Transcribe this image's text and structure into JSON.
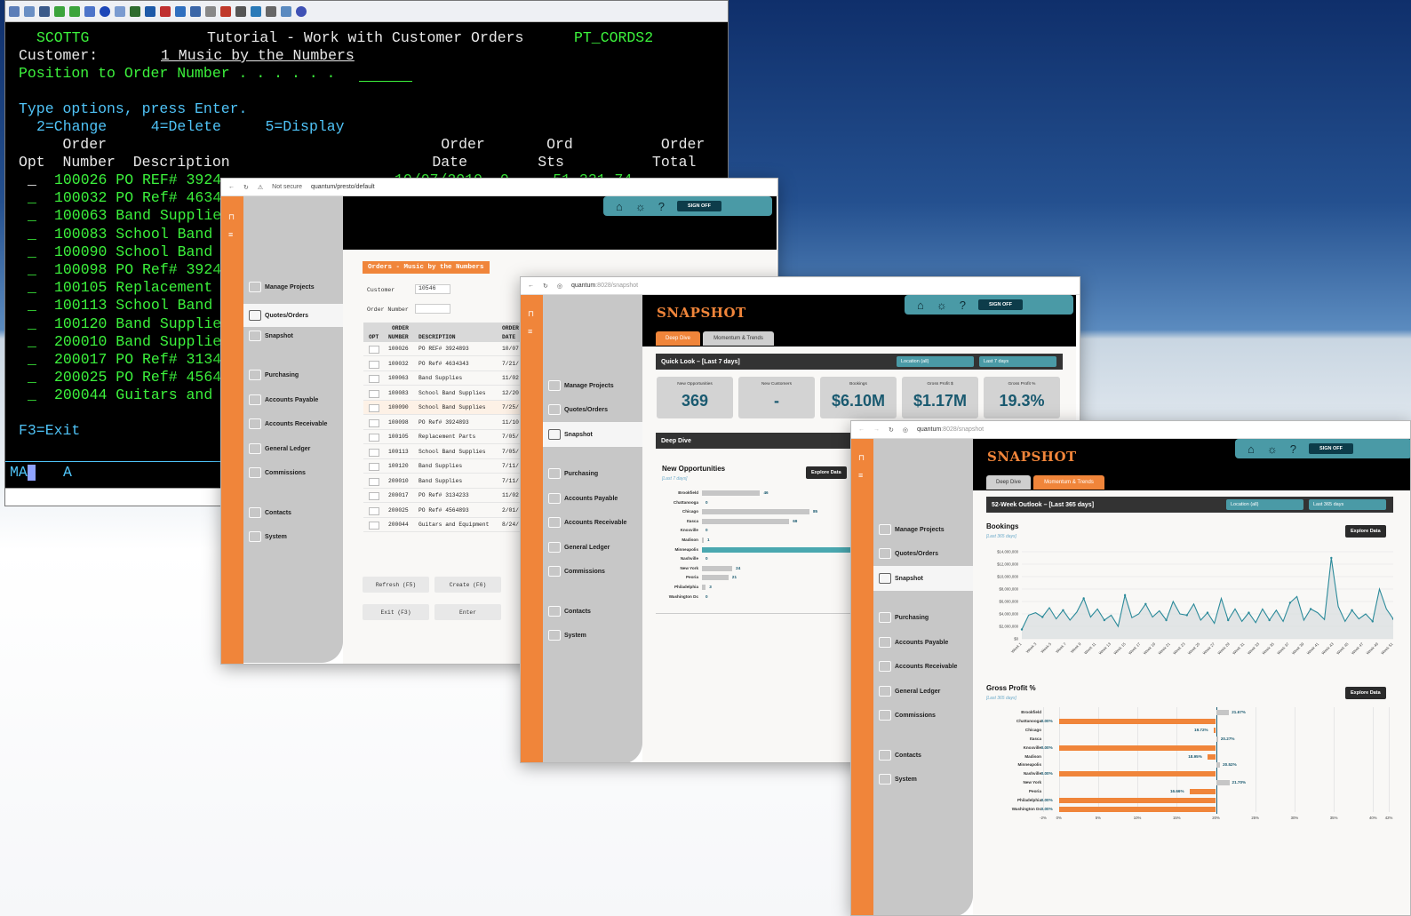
{
  "terminal": {
    "user": "SCOTTG",
    "title": "Tutorial - Work with Customer Orders",
    "program": "PT_CORDS2",
    "customer_label": "Customer:",
    "customer_value": "1 Music by the Numbers",
    "position_label": "Position to Order Number . . . . . .",
    "instructions": "Type options, press Enter.",
    "options": "2=Change     4=Delete     5=Display",
    "col_head1": "     Order                                      Order       Ord          Order",
    "col_head2": "Opt  Number  Description                       Date        Sts          Total",
    "rows": [
      "100026 PO REF# 3924",
      "100032 PO Ref# 4634",
      "100063 Band Supplie",
      "100083 School Band",
      "100090 School Band",
      "100098 PO Ref# 3924",
      "100105 Replacement",
      "100113 School Band",
      "100120 Band Supplie",
      "200010 Band Supplie",
      "200017 PO Ref# 3134",
      "200025 PO Ref# 4564",
      "200044 Guitars and"
    ],
    "first_row_rest": "10/07/2019  0     51,331.74",
    "exit": "F3=Exit",
    "status_left": "MA",
    "status_mid": "A"
  },
  "win1": {
    "not_secure": "Not secure",
    "url": "quantum/presto/default",
    "title": "Orders - Music by the Numbers",
    "customer_label": "Customer",
    "customer_value": "10546",
    "order_number_label": "Order Number",
    "col_order": "ORDER",
    "col_opt": "OPT",
    "col_number": "NUMBER",
    "col_description": "DESCRIPTION",
    "col_order2": "ORDER",
    "col_date": "DATE",
    "rows": [
      {
        "num": "100026",
        "desc": "PO REF# 3924893",
        "date": "10/07"
      },
      {
        "num": "100032",
        "desc": "PO Ref# 4634343",
        "date": "7/21/"
      },
      {
        "num": "100063",
        "desc": "Band Supplies",
        "date": "11/02"
      },
      {
        "num": "100083",
        "desc": "School Band Supplies",
        "date": "12/20"
      },
      {
        "num": "100090",
        "desc": "School Band Supplies",
        "date": "7/25/"
      },
      {
        "num": "100098",
        "desc": "PO Ref# 3924893",
        "date": "11/10"
      },
      {
        "num": "100105",
        "desc": "Replacement Parts",
        "date": "7/05/"
      },
      {
        "num": "100113",
        "desc": "School Band Supplies",
        "date": "7/05/"
      },
      {
        "num": "100120",
        "desc": "Band Supplies",
        "date": "7/11/"
      },
      {
        "num": "200010",
        "desc": "Band Supplies",
        "date": "7/11/"
      },
      {
        "num": "200017",
        "desc": "PO Ref# 3134233",
        "date": "11/02"
      },
      {
        "num": "200025",
        "desc": "PO Ref# 4564893",
        "date": "2/01/"
      },
      {
        "num": "200044",
        "desc": "Guitars and Equipment",
        "date": "8/24/"
      }
    ],
    "refresh": "Refresh (F5)",
    "create": "Create (F6)",
    "exit": "Exit (F3)",
    "enter": "Enter",
    "sign_off": "SIGN OFF"
  },
  "menu": {
    "manage_projects": "Manage Projects",
    "quotes_orders": "Quotes/Orders",
    "snapshot": "Snapshot",
    "purchasing": "Purchasing",
    "accounts_payable": "Accounts Payable",
    "accounts_receivable": "Accounts Receivable",
    "general_ledger": "General Ledger",
    "commissions": "Commissions",
    "contacts": "Contacts",
    "system": "System"
  },
  "win2": {
    "url_host": "quantum",
    "url_path": ":8028/snapshot",
    "title": "SNAPSHOT",
    "tab_deep": "Deep Dive",
    "tab_momentum": "Momentum & Trends",
    "quick_look": "Quick Look – [Last 7 days]",
    "location": "Location (all)",
    "period": "Last 7 days",
    "cards": [
      {
        "title": "New Opportunities",
        "value": "369"
      },
      {
        "title": "New Customers",
        "value": "-"
      },
      {
        "title": "Bookings",
        "value": "$6.10M"
      },
      {
        "title": "Gross Profit $",
        "value": "$1.17M"
      },
      {
        "title": "Gross Profit %",
        "value": "19.3%"
      }
    ],
    "deep_dive": "Deep Dive",
    "new_opps": "New Opportunities",
    "last7": "[Last 7 days]",
    "explore": "Explore Data",
    "sign_off": "SIGN OFF"
  },
  "win3": {
    "url_host": "quantum",
    "url_path": ":8028/snapshot",
    "title": "SNAPSHOT",
    "tab_deep": "Deep Dive",
    "tab_momentum": "Momentum & Trends",
    "outlook": "52-Week Outlook – [Last 365 days]",
    "location": "Location (all)",
    "period": "Last 365 days",
    "bookings": "Bookings",
    "last365": "[Last 365 days]",
    "gross_profit": "Gross Profit %",
    "explore": "Explore Data",
    "sign_off": "SIGN OFF"
  },
  "chart_data": [
    {
      "type": "bar",
      "orientation": "horizontal",
      "title": "New Opportunities",
      "categories": [
        "Brookfield",
        "Chattanooga",
        "Chicago",
        "Itasca",
        "Knoxville",
        "Madison",
        "Minneapolis",
        "Nashville",
        "New York",
        "Peoria",
        "Philadelphia",
        "Washington Dc"
      ],
      "values": [
        46,
        0,
        85,
        69,
        0,
        1,
        130,
        0,
        24,
        21,
        3,
        0
      ]
    },
    {
      "type": "line",
      "title": "Bookings",
      "y_ticks": [
        "$14,000,000",
        "$12,000,000",
        "$10,000,000",
        "$8,000,000",
        "$6,000,000",
        "$4,000,000",
        "$2,000,000",
        "$0"
      ],
      "ylim": [
        0,
        14000000
      ],
      "x_ticks": [
        "Week 1",
        "Week 3",
        "Week 5",
        "Week 7",
        "Week 9",
        "Week 11",
        "Week 13",
        "Week 15",
        "Week 17",
        "Week 19",
        "Week 21",
        "Week 23",
        "Week 25",
        "Week 27",
        "Week 29",
        "Week 31",
        "Week 33",
        "Week 35",
        "Week 37",
        "Week 39",
        "Week 41",
        "Week 43",
        "Week 45",
        "Week 47",
        "Week 49",
        "Week 51"
      ],
      "values": [
        1.5,
        3.8,
        4.2,
        3.5,
        5,
        3.2,
        4.6,
        3,
        4.3,
        6.5,
        3.5,
        4.8,
        3,
        3.8,
        2,
        7,
        3.4,
        4,
        5.6,
        3.5,
        4.5,
        3,
        6,
        4,
        3.8,
        5.6,
        3,
        4.2,
        2.5,
        6.5,
        3,
        4.8,
        2.8,
        4.2,
        2.6,
        4.8,
        3,
        4.6,
        2.8,
        5.8,
        6.8,
        3,
        4.8,
        4.2,
        3.1,
        13,
        5.2,
        2.8,
        4.6,
        3.2,
        4,
        2.8,
        8,
        4.8,
        3.2
      ]
    },
    {
      "type": "bar",
      "orientation": "horizontal",
      "title": "Gross Profit %",
      "categories": [
        "Brookfield",
        "Chattanooga",
        "Chicago",
        "Itasca",
        "Knoxville",
        "Madison",
        "Minneapolis",
        "Nashville",
        "New York",
        "Peoria",
        "Philadelphia",
        "Washington Dc"
      ],
      "values": [
        21.67,
        0,
        19.72,
        20.27,
        0,
        18.95,
        20.52,
        0,
        21.7,
        16.66,
        0,
        0
      ],
      "labels": [
        "21.67%",
        "0.00%",
        "19.72%",
        "20.27%",
        "0.00%",
        "18.95%",
        "20.52%",
        "0.00%",
        "21.70%",
        "16.66%",
        "0.00%",
        "0.00%"
      ],
      "x_ticks": [
        "-2%",
        "0%",
        "5%",
        "10%",
        "15%",
        "20%",
        "25%",
        "30%",
        "35%",
        "40%",
        "42%"
      ],
      "xlim": [
        -2,
        42
      ]
    }
  ]
}
